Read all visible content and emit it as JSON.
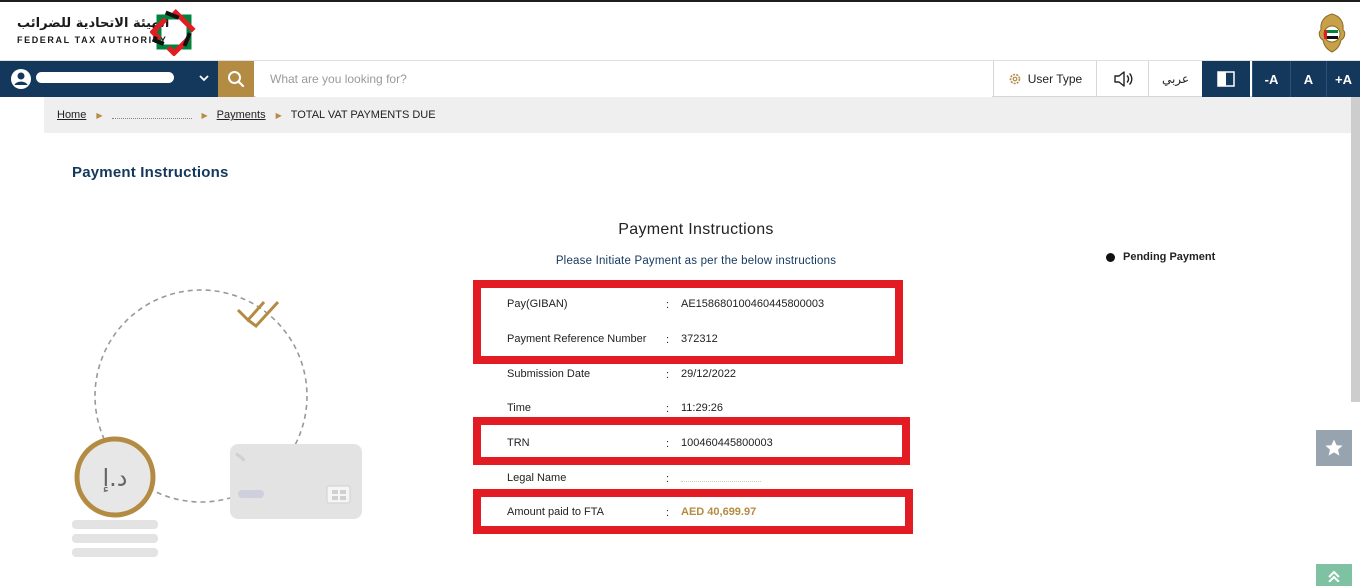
{
  "brand": {
    "name_ar": "الهيئة الاتحادية للضرائب",
    "name_en": "FEDERAL TAX AUTHORITY",
    "logo_icon": "fta-star-logo",
    "emblem_icon": "uae-emblem-icon",
    "colors": {
      "navy": "#14375c",
      "gold": "#b48b43",
      "red": "#e31b23",
      "green": "#00843d"
    }
  },
  "nav": {
    "search_placeholder": "What are you looking for?",
    "user_type_label": "User Type",
    "language_label": "عربي",
    "font_decrease": "-A",
    "font_normal": "A",
    "font_increase": "+A"
  },
  "breadcrumb": {
    "home": "Home",
    "payments": "Payments",
    "current": "TOTAL VAT PAYMENTS DUE"
  },
  "page": {
    "title": "Payment Instructions"
  },
  "instructions": {
    "title": "Payment Instructions",
    "subtitle": "Please Initiate Payment as per the below instructions",
    "rows": [
      {
        "label": "Pay(GIBAN)",
        "value": "AE158680100460445800003"
      },
      {
        "label": "Payment Reference Number",
        "value": "372312"
      },
      {
        "label": "Submission Date",
        "value": "29/12/2022"
      },
      {
        "label": "Time",
        "value": "11:29:26"
      },
      {
        "label": "TRN",
        "value": "100460445800003"
      },
      {
        "label": "Legal Name",
        "value": ""
      },
      {
        "label": "Amount paid to FTA",
        "value": "AED 40,699.97"
      }
    ]
  },
  "status": {
    "label": "Pending Payment"
  },
  "illustration": {
    "coin_symbol": "د.إ"
  }
}
